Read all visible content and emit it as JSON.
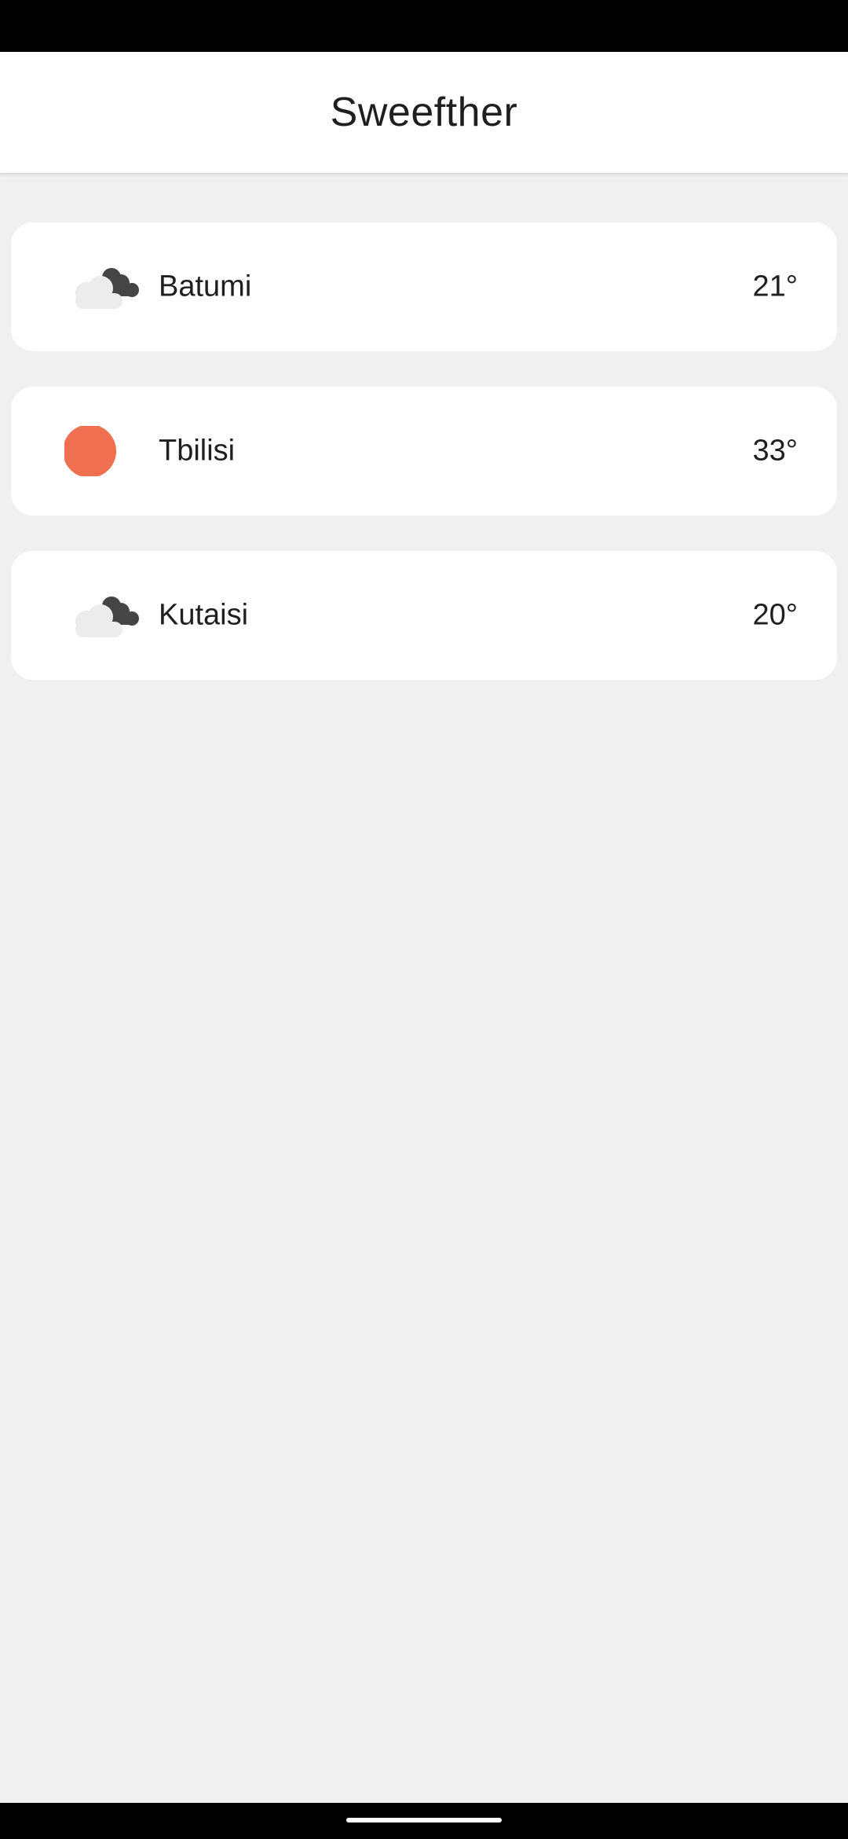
{
  "app": {
    "title": "Sweefther"
  },
  "cities": [
    {
      "name": "Batumi",
      "temperature": "21°",
      "icon": "cloudy-night-icon"
    },
    {
      "name": "Tbilisi",
      "temperature": "33°",
      "icon": "sun-icon"
    },
    {
      "name": "Kutaisi",
      "temperature": "20°",
      "icon": "cloudy-night-icon"
    }
  ],
  "colors": {
    "sun": "#ef6f50",
    "cloud_light": "#ececec",
    "cloud_dark": "#454545",
    "background": "#f0f0f0",
    "card": "#ffffff",
    "text": "#1f1f1f"
  }
}
